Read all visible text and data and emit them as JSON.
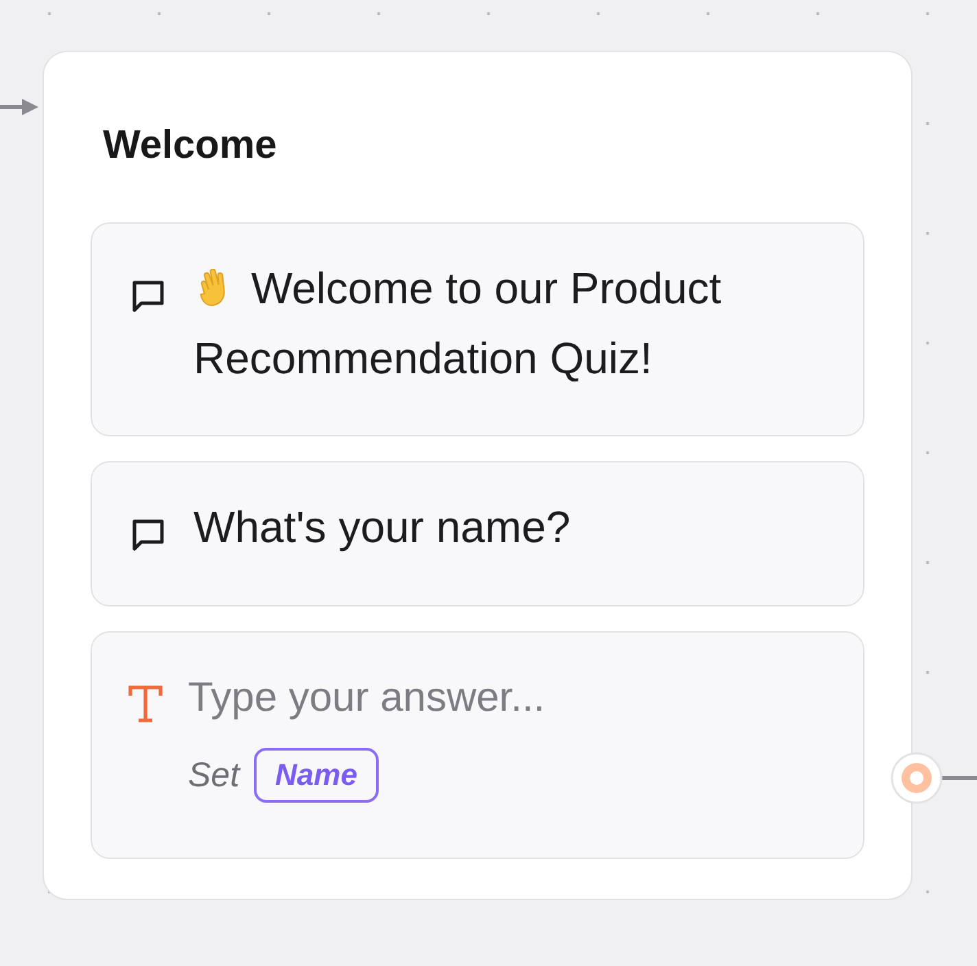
{
  "group": {
    "title": "Welcome",
    "blocks": [
      {
        "kind": "text",
        "text": "Welcome to our Product Recommendation Quiz!",
        "emoji": true
      },
      {
        "kind": "text",
        "text": "What's your name?",
        "emoji": false
      },
      {
        "kind": "input",
        "placeholder": "Type your answer...",
        "set_label": "Set",
        "variable": "Name"
      }
    ]
  }
}
